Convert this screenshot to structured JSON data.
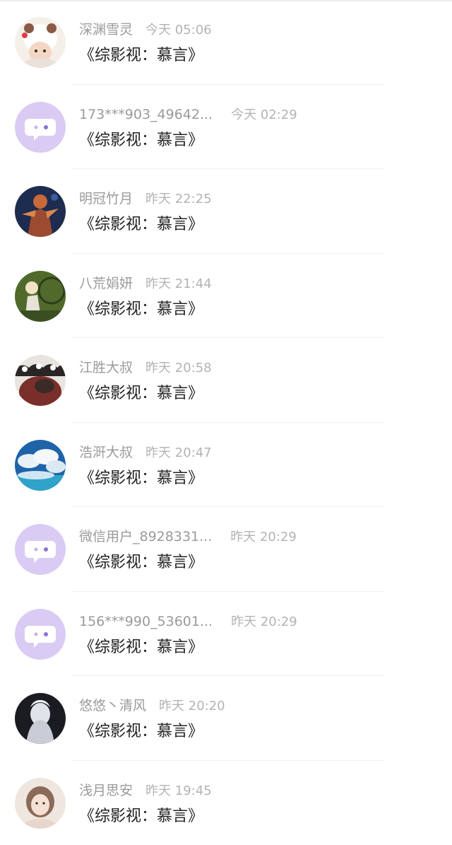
{
  "messages": [
    {
      "name": "深渊雪灵",
      "time": "今天 05:06",
      "text": "《综影视：慕言》",
      "avatar": "photo-avatar"
    },
    {
      "name": "173***903_49642...",
      "time": "今天 02:29",
      "text": "《综影视：慕言》",
      "avatar": "default-chat-avatar"
    },
    {
      "name": "明冠竹月",
      "time": "昨天 22:25",
      "text": "《综影视：慕言》",
      "avatar": "photo-avatar"
    },
    {
      "name": "八荒娟妍",
      "time": "昨天 21:44",
      "text": "《综影视：慕言》",
      "avatar": "photo-avatar"
    },
    {
      "name": "江胜大叔",
      "time": "昨天 20:58",
      "text": "《综影视：慕言》",
      "avatar": "photo-avatar"
    },
    {
      "name": "浩涆大叔",
      "time": "昨天 20:47",
      "text": "《综影视：慕言》",
      "avatar": "photo-avatar"
    },
    {
      "name": "微信用户_8928331...",
      "time": "昨天 20:29",
      "text": "《综影视：慕言》",
      "avatar": "default-chat-avatar"
    },
    {
      "name": "156***990_53601...",
      "time": "昨天 20:29",
      "text": "《综影视：慕言》",
      "avatar": "default-chat-avatar"
    },
    {
      "name": "悠悠丶清风",
      "time": "昨天 20:20",
      "text": "《综影视：慕言》",
      "avatar": "photo-avatar"
    },
    {
      "name": "浅月思安",
      "time": "昨天 19:45",
      "text": "《综影视：慕言》",
      "avatar": "photo-avatar"
    }
  ],
  "colors": {
    "default_avatar_bg": "#d9c8f3",
    "name_text": "#9a9a9a",
    "time_text": "#b3b3b3",
    "message_text": "#222222"
  }
}
